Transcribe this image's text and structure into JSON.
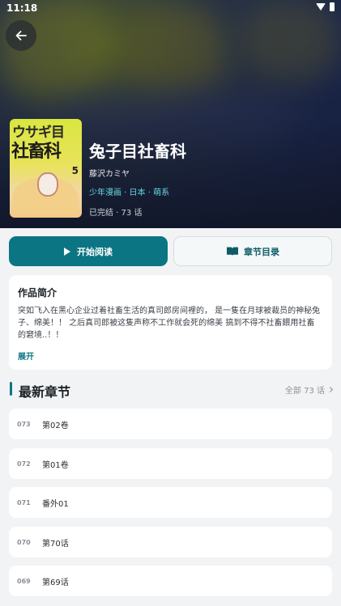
{
  "status_bar": {
    "time": "11:18"
  },
  "book": {
    "title": "兔子目社畜科",
    "author": "藤沢カミヤ",
    "tags": "少年漫画 · 日本 · 萌系",
    "status": "已完结 · 73 话",
    "cover": {
      "line1": "ウサギ目",
      "line2": "社畜科",
      "volume": "5"
    }
  },
  "actions": {
    "read_label": "开始阅读",
    "toc_label": "章节目录"
  },
  "intro": {
    "heading": "作品简介",
    "text": "突如飞入在黑心企业过着社畜生活的真司郎房间裡的， 是一隻在月球被裁员的神秘兔子、绵美！！ 之后真司郎被这隻声称不工作就会死的绵美 搞到不得不社畜餵用社畜的窘境..！！",
    "expand_label": "展开"
  },
  "latest": {
    "heading": "最新章节",
    "all_label": "全部 73 话",
    "chapters": [
      {
        "num": "073",
        "name": "第02卷"
      },
      {
        "num": "072",
        "name": "第01卷"
      },
      {
        "num": "071",
        "name": "番外01"
      },
      {
        "num": "070",
        "name": "第70话"
      },
      {
        "num": "069",
        "name": "第69话"
      }
    ]
  },
  "colors": {
    "accent": "#0c7584",
    "tag": "#68d6e0",
    "background": "#f1f3f4"
  }
}
